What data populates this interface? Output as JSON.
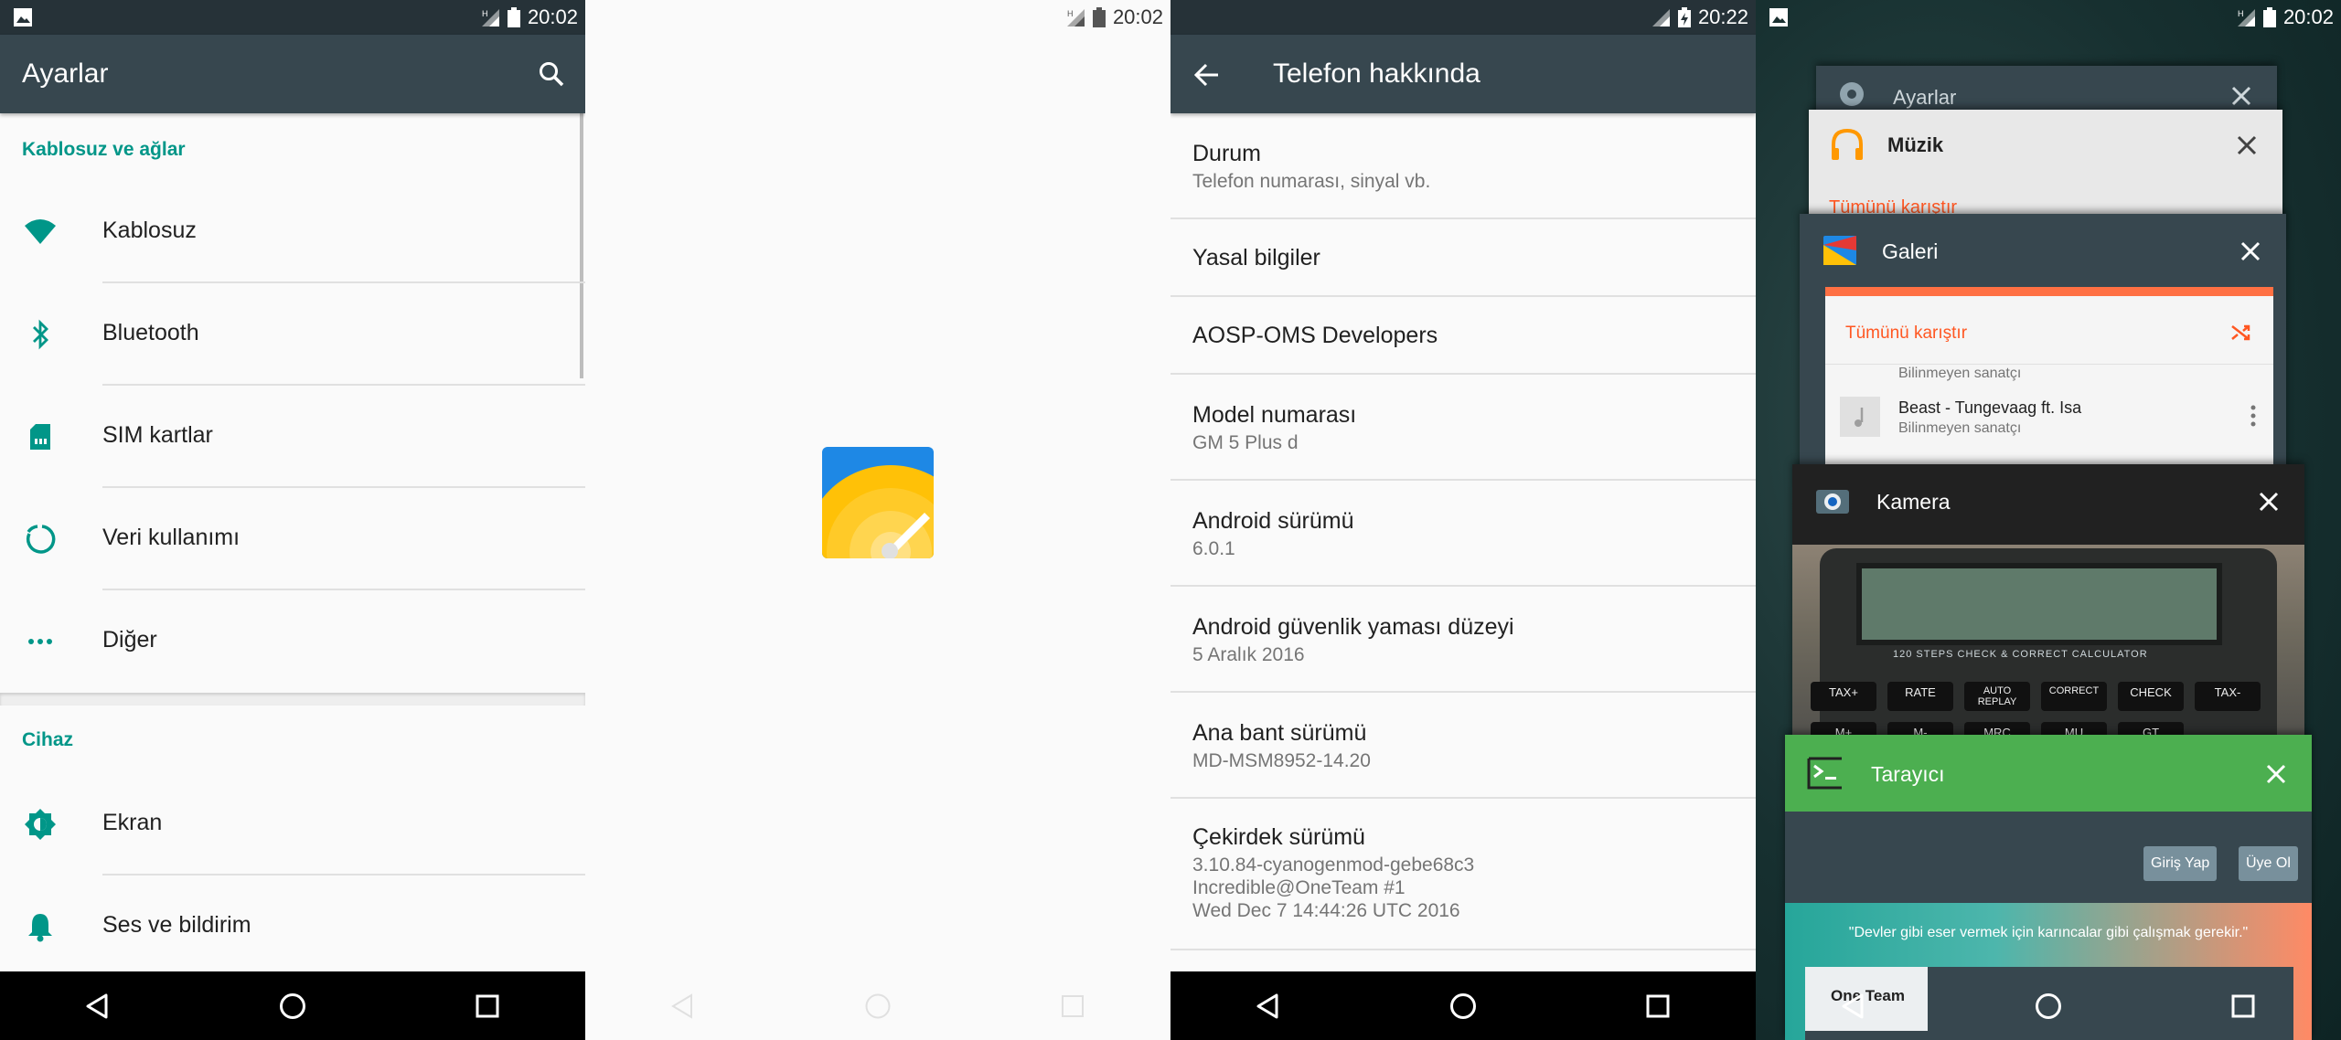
{
  "panel1": {
    "status_time": "20:02",
    "title": "Ayarlar",
    "section1": "Kablosuz ve ağlar",
    "items1": [
      {
        "label": "Kablosuz",
        "icon": "wifi-icon"
      },
      {
        "label": "Bluetooth",
        "icon": "bluetooth-icon"
      },
      {
        "label": "SIM kartlar",
        "icon": "sim-card-icon"
      },
      {
        "label": "Veri kullanımı",
        "icon": "data-usage-icon"
      },
      {
        "label": "Diğer",
        "icon": "more-horiz-icon"
      }
    ],
    "section2": "Cihaz",
    "items2": [
      {
        "label": "Ekran",
        "icon": "brightness-icon"
      },
      {
        "label": "Ses ve bildirim",
        "icon": "bell-icon"
      }
    ]
  },
  "panel2": {
    "status_time": "20:02"
  },
  "panel3": {
    "status_time": "20:22",
    "title": "Telefon hakkında",
    "rows": [
      {
        "title": "Durum",
        "sub": "Telefon numarası, sinyal vb."
      },
      {
        "title": "Yasal bilgiler",
        "sub": ""
      },
      {
        "title": "AOSP-OMS Developers",
        "sub": ""
      },
      {
        "title": "Model numarası",
        "sub": "GM 5 Plus d"
      },
      {
        "title": "Android sürümü",
        "sub": "6.0.1"
      },
      {
        "title": "Android güvenlik yaması düzeyi",
        "sub": "5 Aralık 2016"
      },
      {
        "title": "Ana bant sürümü",
        "sub": "MD-MSM8952-14.20"
      },
      {
        "title": "Çekirdek sürümü",
        "sub": "3.10.84-cyanogenmod-gebe68c3\nIncredible@OneTeam #1\nWed Dec 7 14:44:26 UTC 2016"
      }
    ]
  },
  "panel4": {
    "status_time": "20:02",
    "cards": [
      {
        "title": "Ayarlar"
      },
      {
        "title": "Müzik",
        "peek": "Tümünü karıştır"
      },
      {
        "title": "Galeri",
        "shuffle": "Tümünü karıştır",
        "artist1": "Bilinmeyen sanatçı",
        "song": "Beast - Tungevaag ft. Isa",
        "artist2": "Bilinmeyen sanatçı"
      },
      {
        "title": "Kamera",
        "calc_text": "120 STEPS CHECK & CORRECT CALCULATOR",
        "keys": [
          "TAX+",
          "RATE",
          "AUTO REPLAY",
          "CORRECT",
          "CHECK",
          "TAX-",
          "M+",
          "M-",
          "MRC",
          "MU",
          "GT"
        ]
      },
      {
        "title": "Tarayıcı",
        "login": "Giriş Yap",
        "signup": "Üye Ol",
        "quote": "\"Devler gibi eser vermek için karıncalar gibi çalışmak gerekir.\"",
        "tab": "One Team"
      }
    ],
    "colors": {
      "green": "#4caf50",
      "orange": "#ff5722"
    }
  }
}
